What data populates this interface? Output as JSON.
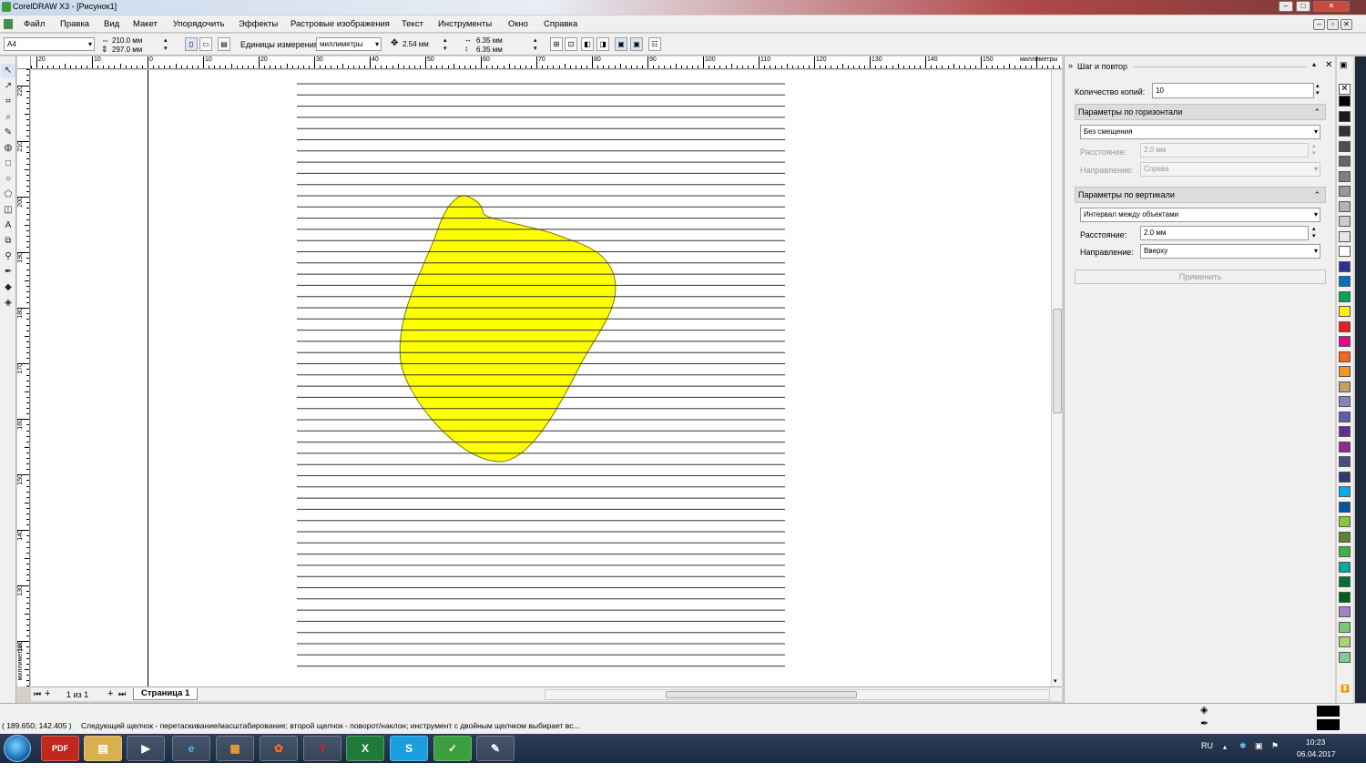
{
  "window": {
    "title": "CorelDRAW X3 - [Рисунок1]"
  },
  "menu": [
    "Файл",
    "Правка",
    "Вид",
    "Макет",
    "Упорядочить",
    "Эффекты",
    "Растровые изображения",
    "Текст",
    "Инструменты",
    "Окно",
    "Справка"
  ],
  "propbar": {
    "paper": "A4",
    "width": "210.0 мм",
    "height": "297.0 мм",
    "units_label": "Единицы измерения:",
    "units": "миллиметры",
    "nudge": "2.54 мм",
    "dup_x": "6.35 мм",
    "dup_y": "6.35 мм"
  },
  "ruler": {
    "h_labels": [
      "20",
      "10",
      "0",
      "10",
      "20",
      "30",
      "40",
      "50",
      "60",
      "70",
      "80",
      "90",
      "100",
      "110",
      "120",
      "130",
      "140",
      "150"
    ],
    "h_unit": "миллиметры",
    "v_labels": [
      "220",
      "210",
      "200",
      "190",
      "180",
      "170",
      "160",
      "150",
      "140",
      "130",
      "120"
    ],
    "v_unit": "миллиметры"
  },
  "pagebar": {
    "count": "1 из 1",
    "tab": "Страница 1"
  },
  "docker": {
    "title": "Шаг и повтор",
    "copies_label": "Количество копий:",
    "copies": "10",
    "horiz": {
      "header": "Параметры по горизонтали",
      "mode": "Без смещения",
      "dist_label": "Расстояние:",
      "dist": "2.0 мм",
      "dir_label": "Направление:",
      "dir": "Справа"
    },
    "vert": {
      "header": "Параметры по вертикали",
      "mode": "Интервал между объектами",
      "dist_label": "Расстояние:",
      "dist": "2.0 мм",
      "dir_label": "Направление:",
      "dir": "Вверху"
    },
    "apply": "Применить"
  },
  "status": {
    "coords": "( 189.650; 142.405 )",
    "hint": "Следующий щелчок - перетаскивание/масштабирование; второй щелчок - поворот/наклон; инструмент с двойным щелчком выбирает вс..."
  },
  "taskbar": {
    "lang": "RU",
    "time": "10:23",
    "date": "06.04.2017"
  },
  "colors": {
    "shape_fill": "#ffff00",
    "shape_stroke": "#8a8a00",
    "line": "#333333"
  },
  "palette": [
    "#000000",
    "#1a1a1a",
    "#333333",
    "#4d4d4d",
    "#666666",
    "#808080",
    "#999999",
    "#b3b3b3",
    "#cccccc",
    "#e6e6e6",
    "#ffffff",
    "#2e3192",
    "#0072bc",
    "#00a651",
    "#fff200",
    "#ed1c24",
    "#ec008c",
    "#f26522",
    "#f7941d",
    "#c69c6d",
    "#8781bd",
    "#605ca8",
    "#662d91",
    "#92278f",
    "#464e7d",
    "#2e3b6e",
    "#00aeef",
    "#0054a6",
    "#8dc63f",
    "#598527",
    "#39b54a",
    "#00a99d",
    "#007236",
    "#005e20",
    "#a186be",
    "#7cc576",
    "#acd373",
    "#82ca9c"
  ],
  "tools": [
    "pick-tool",
    "shape-tool",
    "crop-tool",
    "zoom-tool",
    "freehand-tool",
    "smart-fill-tool",
    "rectangle-tool",
    "ellipse-tool",
    "polygon-tool",
    "basic-shapes-tool",
    "text-tool",
    "interactive-blend-tool",
    "eyedropper-tool",
    "outline-tool",
    "fill-tool",
    "interactive-fill-tool"
  ]
}
